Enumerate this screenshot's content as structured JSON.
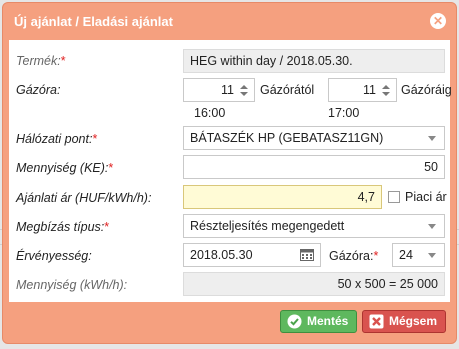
{
  "dialog": {
    "title": "Új ajánlat / Eladási ajánlat",
    "close_icon": "close-icon"
  },
  "form": {
    "product": {
      "label": "Termék:",
      "value": "HEG within day / 2018.05.30."
    },
    "hour_from": {
      "label": "Gázóra:",
      "value": "11",
      "suffix": "Gázórától",
      "time": "16:00"
    },
    "hour_to": {
      "value": "11",
      "suffix": "Gázóráig",
      "time": "17:00"
    },
    "network_point": {
      "label": "Hálózati pont:",
      "value": "BÁTASZÉK HP (GEBATASZ11GN)"
    },
    "quantity": {
      "label": "Mennyiség (KE):",
      "value": "50"
    },
    "price": {
      "label": "Ajánlati ár (HUF/kWh/h):",
      "value": "4,7",
      "market_label": "Piaci ár"
    },
    "order_type": {
      "label": "Megbízás típus:",
      "value": "Részteljesítés megengedett"
    },
    "validity": {
      "label": "Érvényesség:",
      "date": "2018.05.30",
      "hour_label": "Gázóra:",
      "hour": "24"
    },
    "quantity_kwh": {
      "label": "Mennyiség (kWh/h):",
      "value": "50 x 500 = 25 000"
    },
    "required_marker": "*"
  },
  "buttons": {
    "save": "Mentés",
    "cancel": "Mégsem"
  },
  "colors": {
    "accent": "#f5a07f",
    "save": "#5eb85e",
    "cancel": "#d9534f",
    "highlight": "#fffbd6"
  }
}
